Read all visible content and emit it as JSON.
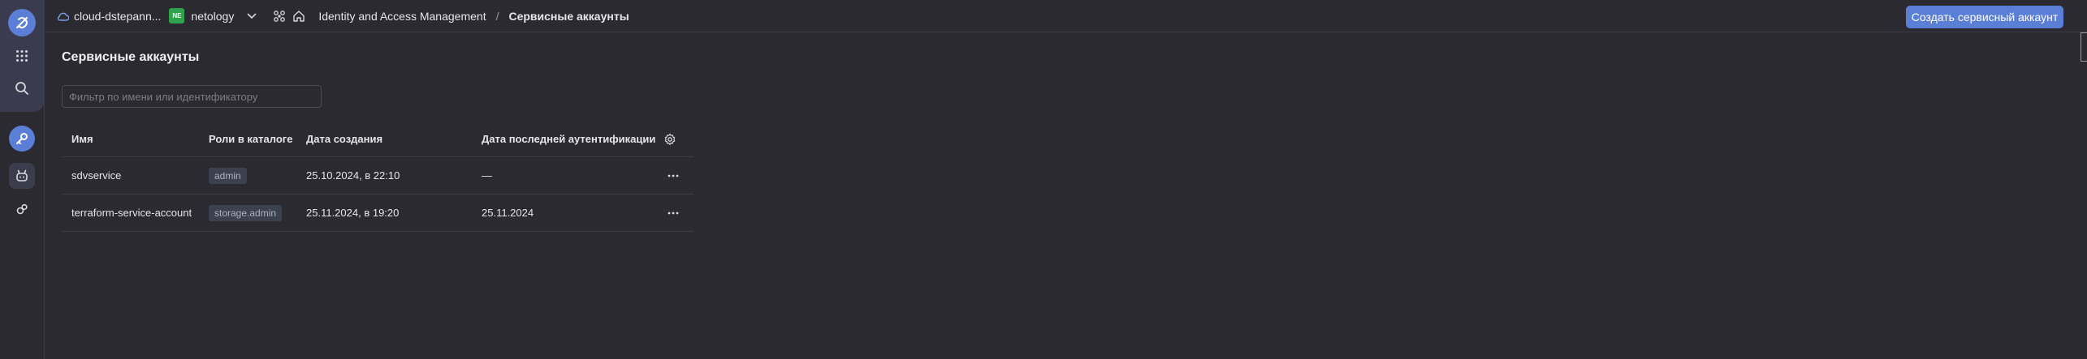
{
  "topbar": {
    "cloud_name": "cloud-dstepann...",
    "folder_badge": "NE",
    "folder_name": "netology",
    "service": "Identity and Access Management",
    "separator": "/",
    "current_page": "Сервисные аккаунты",
    "create_button": "Создать сервисный аккаунт"
  },
  "page": {
    "title": "Сервисные аккаунты",
    "filter_placeholder": "Фильтр по имени или идентификатору"
  },
  "table": {
    "columns": {
      "name": "Имя",
      "roles": "Роли в каталоге",
      "created": "Дата создания",
      "last_auth": "Дата последней аутентификации"
    },
    "rows": [
      {
        "name": "sdvservice",
        "role": "admin",
        "created": "25.10.2024, в 22:10",
        "last_auth": "—"
      },
      {
        "name": "terraform-service-account",
        "role": "storage.admin",
        "created": "25.11.2024, в 19:20",
        "last_auth": "25.11.2024"
      }
    ]
  },
  "icons": {
    "rail": [
      "yandex-cloud-logo-icon",
      "apps-grid-icon",
      "search-icon",
      "key-icon",
      "robot-icon",
      "settings-cogs-icon"
    ],
    "topbar": [
      "cloud-icon",
      "chevron-down-icon",
      "drone-icon",
      "home-icon"
    ],
    "table": [
      "settings-gear-icon",
      "more-dots-icon"
    ]
  },
  "colors": {
    "accent": "#5b7fd6",
    "folder_badge": "#2fa34c",
    "background": "#2a2a30",
    "rail_top": "#3a3b4e"
  }
}
